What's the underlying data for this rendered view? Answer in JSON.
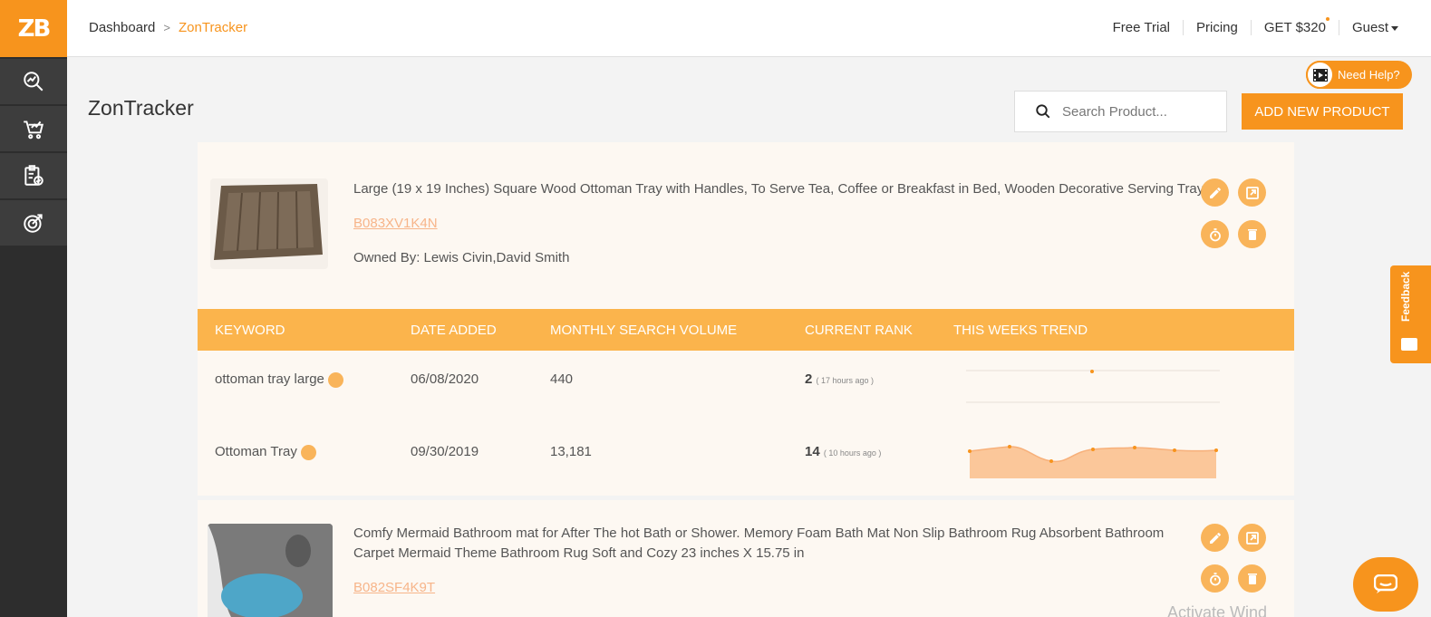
{
  "logo": {
    "text": "ZB"
  },
  "sidebar": {
    "items": [
      {
        "icon": "analytics-search-icon"
      },
      {
        "icon": "cart-trend-icon"
      },
      {
        "icon": "clipboard-check-icon"
      },
      {
        "icon": "target-chart-icon"
      }
    ]
  },
  "breadcrumb": {
    "home": "Dashboard",
    "separator": ">",
    "current": "ZonTracker"
  },
  "topnav": {
    "free_trial": "Free Trial",
    "pricing": "Pricing",
    "get": "GET $320",
    "user": "Guest"
  },
  "help": {
    "label": "Need Help?"
  },
  "page": {
    "title": "ZonTracker"
  },
  "search": {
    "placeholder": "Search Product..."
  },
  "actions": {
    "add_product": "ADD NEW PRODUCT"
  },
  "table": {
    "headers": [
      "KEYWORD",
      "DATE ADDED",
      "MONTHLY SEARCH VOLUME",
      "CURRENT RANK",
      "THIS WEEKS TREND"
    ]
  },
  "products": [
    {
      "title": "Large (19 x 19 Inches) Square Wood Ottoman Tray with Handles, To Serve Tea, Coffee or Breakfast in Bed, Wooden Decorative Serving Tray",
      "asin": "B083XV1K4N",
      "owner": "Owned By: Lewis Civin,David Smith",
      "keywords": [
        {
          "keyword": "ottoman tray large",
          "date": "06/08/2020",
          "volume": "440",
          "rank": "2",
          "ago": "( 17 hours ago )"
        },
        {
          "keyword": "Ottoman Tray",
          "date": "09/30/2019",
          "volume": "13,181",
          "rank": "14",
          "ago": "( 10 hours ago )"
        }
      ]
    },
    {
      "title": "Comfy Mermaid Bathroom mat for After The hot Bath or Shower. Memory Foam Bath Mat Non Slip Bathroom Rug Absorbent Bathroom Carpet Mermaid Theme Bathroom Rug Soft and Cozy 23 inches X 15.75 in",
      "asin": "B082SF4K9T"
    }
  ],
  "feedback": {
    "label": "Feedback"
  },
  "watermark": {
    "text": "Activate Wind"
  },
  "colors": {
    "accent": "#f7941d",
    "table_header": "#fbb44c",
    "sidebar": "#2d2d2d",
    "card": "#fdf8f2"
  }
}
